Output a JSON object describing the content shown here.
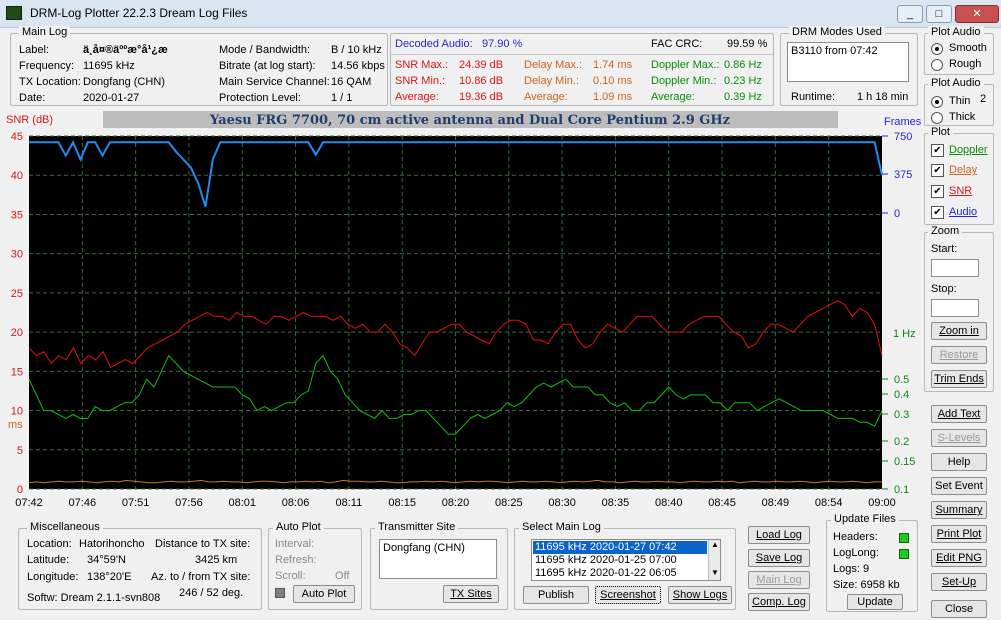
{
  "window": {
    "title": "DRM-Log Plotter 22.2.3    Dream Log Files",
    "min": "_",
    "max": "□",
    "close": "✕"
  },
  "mainlog": {
    "legend": "Main Log",
    "label_k": "Label:",
    "label_v": "ä¸­å¤®äººæ°å¹¿æ­",
    "freq_k": "Frequency:",
    "freq_v": "11695   kHz",
    "tx_k": "TX Location:",
    "tx_v": "Dongfang (CHN)",
    "date_k": "Date:",
    "date_v": "2020-01-27",
    "mode_k": "Mode / Bandwidth:",
    "mode_v": "B / 10 kHz",
    "bitrate_k": "Bitrate (at log start):",
    "bitrate_v": "14.56 kbps",
    "msc_k": "Main Service Channel:",
    "msc_v": "16  QAM",
    "prot_k": "Protection Level:",
    "prot_v": "1 / 1"
  },
  "stats": {
    "decoded_k": "Decoded Audio:",
    "decoded_v": "97.90 %",
    "fac_k": "FAC  CRC:",
    "fac_v": "99.59 %",
    "snrmax_k": "SNR Max.:",
    "snrmax_v": "24.39  dB",
    "snrmin_k": "SNR Min.:",
    "snrmin_v": "10.86  dB",
    "snravg_k": "Average:",
    "snravg_v": "19.36  dB",
    "dmax_k": "Delay Max.:",
    "dmax_v": "1.74    ms",
    "dmin_k": "Delay Min.:",
    "dmin_v": "0.10    ms",
    "davg_k": "Average:",
    "davg_v": "1.09    ms",
    "dopmax_k": "Doppler Max.:",
    "dopmax_v": "0.86 Hz",
    "dopmin_k": "Doppler Min.:",
    "dopmin_v": "0.23 Hz",
    "dopavg_k": "Average:",
    "dopavg_v": "0.39 Hz"
  },
  "modes": {
    "legend": "DRM Modes Used",
    "entry": "B3110 from 07:42",
    "runtime_k": "Runtime:",
    "runtime_v": "1 h 18 min"
  },
  "plotaudio": {
    "legend": "Plot Audio",
    "smooth": "Smooth",
    "rough": "Rough"
  },
  "plotaudio2": {
    "legend": "Plot Audio",
    "thin": "Thin",
    "thick": "Thick",
    "num": "2"
  },
  "plotsel": {
    "legend": "Plot",
    "doppler": "Doppler",
    "delay": "Delay",
    "snr": "SNR",
    "audio": "Audio"
  },
  "zoom": {
    "legend": "Zoom",
    "start": "Start:",
    "stop": "Stop:",
    "zoomin": "Zoom in",
    "restore": "Restore",
    "trim": "Trim Ends"
  },
  "sidebtns": {
    "addtext": "Add Text",
    "slevels": "S-Levels",
    "help": "Help",
    "setevent": "Set Event",
    "summary": "Summary",
    "printplot": "Print Plot",
    "editpng": "Edit PNG",
    "setup": "Set-Up",
    "close": "Close"
  },
  "chart_data": {
    "type": "line",
    "title": "Yaesu FRG 7700, 70 cm active antenna and Dual Core Pentium 2.9 GHz",
    "ylabel_left": "SNR (dB)",
    "ylabel_left2": "ms",
    "ylabel_right": "Frames",
    "ylabel_right2": "1 Hz",
    "x_ticks": [
      "07:42",
      "07:46",
      "07:51",
      "07:56",
      "08:01",
      "08:06",
      "08:11",
      "08:15",
      "08:20",
      "08:25",
      "08:30",
      "08:35",
      "08:40",
      "08:45",
      "08:49",
      "08:54",
      "09:00"
    ],
    "y_ticks": [
      "0",
      "5",
      "10",
      "15",
      "20",
      "25",
      "30",
      "35",
      "40",
      "45"
    ],
    "frames_ticks": [
      "750",
      "375",
      "0"
    ],
    "hz_ticks": [
      "0.5",
      "0.4",
      "0.3",
      "0.2",
      "0.15",
      "0.1"
    ],
    "ylim": [
      0,
      45
    ],
    "series": [
      {
        "name": "SNR",
        "color": "#e01010",
        "values": [
          18,
          17,
          17.5,
          16,
          17,
          16.5,
          18,
          16,
          17,
          16.5,
          17.5,
          15.5,
          16,
          16.5,
          16,
          17,
          18,
          18.5,
          19,
          19.5,
          20,
          21,
          21.5,
          22,
          22.5,
          22,
          22,
          21.5,
          22.5,
          22,
          22,
          21.5,
          21,
          22,
          22,
          21.5,
          22,
          22.5,
          22,
          22,
          22,
          21.5,
          22,
          21,
          20.5,
          21,
          20,
          20,
          21,
          20,
          18.5,
          18,
          17,
          18.5,
          20,
          20,
          20.5,
          21,
          21,
          20,
          19.5,
          19,
          18.5,
          20,
          21,
          21.5,
          21.5,
          21,
          19,
          19,
          18.5,
          20,
          21,
          21,
          19,
          18,
          18.5,
          20,
          21,
          20.5,
          20,
          21,
          22,
          22,
          22,
          21,
          20,
          20,
          20,
          21,
          21.5,
          22,
          22,
          22,
          21,
          20,
          19.5,
          18,
          18.5,
          20,
          21,
          21,
          20.5,
          20,
          21,
          22,
          22.5,
          23,
          23.5,
          24,
          23.5,
          22,
          23,
          22.5,
          21,
          17
        ]
      },
      {
        "name": "Doppler",
        "color": "#10c010",
        "values": [
          14,
          12,
          10,
          10,
          9.5,
          9,
          9.5,
          9,
          9,
          10.5,
          10,
          10,
          10.5,
          11,
          11,
          12,
          14,
          13,
          15,
          17,
          16,
          15,
          14.5,
          14,
          13.5,
          13,
          13,
          13,
          13,
          12,
          11.5,
          10,
          10.5,
          10,
          10.5,
          11,
          11,
          12,
          12.5,
          16,
          17,
          15,
          14,
          12,
          11,
          10,
          9.5,
          9,
          10,
          9,
          9,
          9.5,
          9.5,
          10,
          10,
          9,
          8,
          7,
          7,
          8,
          9,
          9.5,
          9,
          9.5,
          10,
          11,
          10.5,
          11,
          12,
          13,
          13.5,
          13,
          13.5,
          14,
          13,
          13,
          13,
          12,
          12,
          11,
          10.5,
          11,
          10,
          10,
          11,
          11,
          12,
          13,
          12,
          11.5,
          12,
          12,
          12,
          11,
          11,
          10,
          11,
          11,
          11,
          10,
          10.5,
          11,
          11.5,
          11,
          10.5,
          10,
          10,
          10,
          10,
          9.5,
          9,
          9,
          9,
          8.5,
          8.5,
          8,
          10
        ]
      },
      {
        "name": "Delay",
        "color": "#c8781e",
        "values": [
          0.8,
          0.9,
          0.8,
          0.9,
          1,
          0.9,
          0.9,
          1,
          0.9,
          0.8,
          0.9,
          1,
          0.9,
          1.1,
          1,
          0.9,
          0.8,
          0.8,
          0.9,
          1,
          0.9,
          0.9,
          1,
          1.1,
          0.9,
          0.9,
          1,
          0.9,
          0.9,
          0.8,
          0.9,
          1,
          1,
          0.9,
          0.8,
          0.9,
          0.9,
          1,
          0.9,
          1,
          0.8,
          0.9,
          1.1,
          1,
          1,
          0.9,
          0.9,
          1,
          0.9,
          0.8,
          0.8,
          0.9,
          0.9,
          1,
          0.9,
          1,
          0.9,
          0.8,
          0.9,
          1,
          0.9,
          1,
          1,
          0.9,
          0.8,
          0.9,
          1,
          0.9,
          0.9,
          1,
          0.9,
          0.8,
          0.9,
          1,
          0.9,
          1,
          1.1,
          0.9,
          0.9,
          0.8,
          0.9,
          1,
          0.9,
          0.9,
          1,
          0.9,
          0.9,
          0.8,
          0.9,
          1,
          0.9,
          0.9,
          1,
          0.9,
          1,
          0.8,
          0.9,
          1,
          0.9,
          0.9,
          1,
          0.9,
          0.9,
          1,
          0.9,
          0.8,
          0.9,
          1,
          0.9,
          0.9,
          1,
          0.9,
          0.8,
          0.9,
          0.9
        ]
      },
      {
        "name": "Audio",
        "color": "#1e8cf0",
        "values": [
          44.2,
          44.2,
          44.2,
          44.2,
          44.2,
          42.5,
          44.2,
          42,
          44.2,
          44.2,
          42.5,
          44.2,
          44.2,
          44.2,
          44.2,
          44.2,
          44.2,
          44.2,
          44.2,
          44.2,
          43,
          42,
          41,
          39,
          36,
          42,
          44.2,
          44.2,
          44.2,
          44.2,
          44.2,
          44.2,
          44.2,
          44.2,
          44.2,
          44.2,
          44.2,
          44.2,
          44.2,
          42.6,
          44.2,
          44.2,
          44.2,
          44.2,
          44.2,
          44.2,
          44.2,
          44.2,
          44.2,
          44.2,
          44.2,
          44.2,
          44.2,
          44.2,
          44.2,
          44.2,
          44.2,
          44.2,
          44.2,
          44.2,
          44.2,
          44.2,
          44.2,
          44.2,
          44.2,
          44.2,
          44.2,
          44.2,
          44.2,
          44.2,
          44.2,
          44.2,
          44.2,
          44.2,
          44.2,
          44.2,
          44.2,
          44.2,
          44.2,
          44.2,
          44.2,
          44.2,
          44.2,
          44.2,
          44.2,
          44.2,
          44.2,
          44.2,
          44.2,
          44.2,
          44.2,
          44.2,
          44.2,
          44.2,
          44.2,
          44.2,
          44.2,
          44.2,
          44.2,
          44.2,
          44.2,
          44.2,
          44.2,
          44.2,
          44.2,
          44.2,
          44.2,
          44.2,
          44.2,
          44.2,
          44.2,
          44.2,
          44.2,
          44.2,
          44.2,
          44.2,
          40
        ]
      }
    ]
  },
  "misc": {
    "legend": "Miscellaneous",
    "loc_k": "Location:",
    "loc_v": "Hatorihoncho",
    "dist_k": "Distance to TX site:",
    "dist_v": "3425    km",
    "lat_k": "Latitude:",
    "lat_v": "34°59'N",
    "lon_k": "Longitude:",
    "lon_v": "138°20'E",
    "az_k": "Az. to / from TX site:",
    "az_v": "246 / 52  deg.",
    "softw": "Softw: Dream 2.1.1-svn808"
  },
  "autoplot": {
    "legend": "Auto Plot",
    "interval": "Interval:",
    "refresh": "Refresh:",
    "scroll": "Scroll:",
    "off": "Off",
    "btn": "Auto Plot"
  },
  "txsite": {
    "legend": "Transmitter Site",
    "entry": "Dongfang (CHN)",
    "btn": "TX Sites"
  },
  "selectlog": {
    "legend": "Select Main Log",
    "rows": [
      "11695 kHz  2020-01-27    07:42",
      "11695 kHz  2020-01-25    07:00",
      "11695 kHz  2020-01-22    06:05"
    ],
    "publish": "Publish",
    "screenshot": "Screenshot",
    "showlogs": "Show Logs"
  },
  "logbtns": {
    "load": "Load Log",
    "save": "Save Log",
    "main": "Main Log",
    "comp": "Comp. Log"
  },
  "update": {
    "legend": "Update Files",
    "headers": "Headers:",
    "loglong": "LogLong:",
    "logs": "Logs: 9",
    "size": "Size:   6958 kb",
    "btn": "Update"
  }
}
